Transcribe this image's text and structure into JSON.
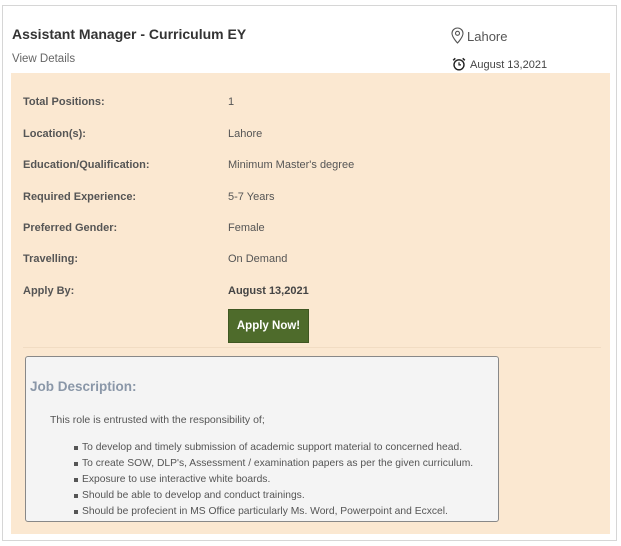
{
  "job": {
    "title": "Assistant Manager - Curriculum EY",
    "view_details": "View Details",
    "location": "Lahore",
    "date": "August 13,2021"
  },
  "details": [
    {
      "label": "Total Positions:",
      "value": "1"
    },
    {
      "label": "Location(s):",
      "value": "Lahore"
    },
    {
      "label": "Education/Qualification:",
      "value": "Minimum Master's degree"
    },
    {
      "label": "Required Experience:",
      "value": "5-7 Years"
    },
    {
      "label": "Preferred Gender:",
      "value": "Female"
    },
    {
      "label": "Travelling:",
      "value": "On Demand"
    },
    {
      "label": "Apply By:",
      "value": "August 13,2021"
    }
  ],
  "apply_button": "Apply Now!",
  "description": {
    "title": "Job Description:",
    "intro": "This role is entrusted with the responsibility of;",
    "items": [
      "To develop and timely submission of academic support material to concerned head.",
      "To create SOW, DLP's, Assessment / examination papers as per the given curriculum.",
      "Exposure to use interactive white boards.",
      "Should be able to develop and conduct trainings.",
      "Should be profecient in MS Office particularly Ms. Word, Powerpoint and Ecxcel."
    ]
  },
  "icons": {
    "location": "map-pin-icon",
    "date": "alarm-clock-icon"
  },
  "colors": {
    "details_bg": "#fbe8d1",
    "apply_button": "#4e6b2b",
    "description_title": "#8a97a8"
  }
}
